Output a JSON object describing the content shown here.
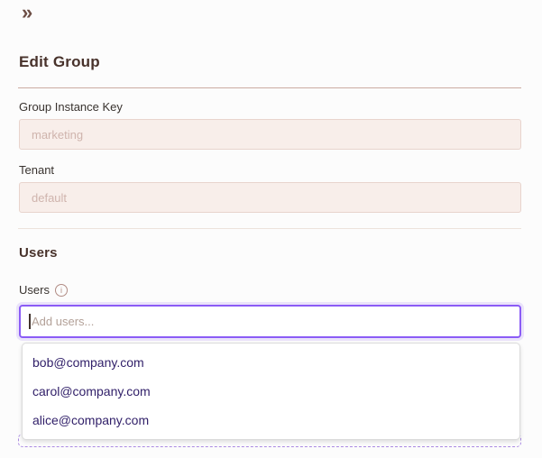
{
  "header": {
    "collapse_icon": "»",
    "title": "Edit Group"
  },
  "group_form": {
    "instance_key_field": {
      "label": "Group Instance Key",
      "value": "marketing",
      "state": "disabled"
    },
    "tenant_field": {
      "label": "Tenant",
      "value": "default",
      "state": "disabled"
    }
  },
  "users_section": {
    "heading": "Users",
    "users_field": {
      "label": "Users",
      "info_icon_glyph": "i",
      "placeholder": "Add users...",
      "state": "focused"
    },
    "dropdown": {
      "options": [
        "bob@company.com",
        "carol@company.com",
        "alice@company.com"
      ]
    }
  },
  "colors": {
    "page_background": "#fcfcfc",
    "heading_text": "#48322b",
    "divider_rose": "#cbaba2",
    "disabled_input_background": "#f8eeea",
    "disabled_input_border": "#e8d4cd",
    "disabled_input_text": "#cfb4ad",
    "focus_accent_purple": "#8b5cf6",
    "dashed_outline_purple": "#aa8ae2",
    "dropdown_option_text": "#32216a",
    "info_icon_rose": "#b18c84"
  }
}
